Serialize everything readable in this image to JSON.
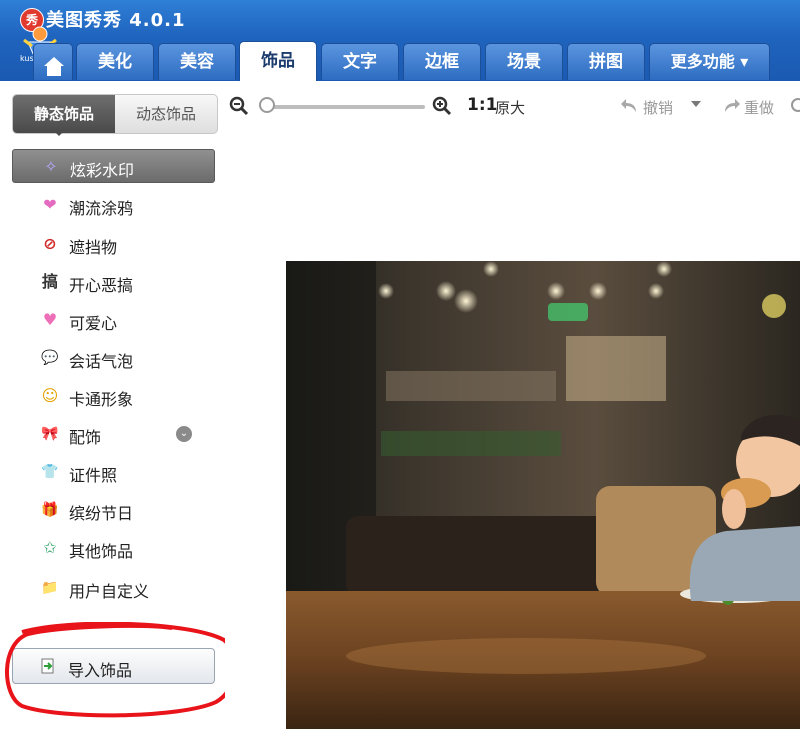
{
  "app": {
    "title": "美图秀秀 4.0.1",
    "logo_text": "秀",
    "mascot_text": "kusfoto"
  },
  "tabs": [
    {
      "label": "美化"
    },
    {
      "label": "美容"
    },
    {
      "label": "饰品",
      "active": true
    },
    {
      "label": "文字"
    },
    {
      "label": "边框"
    },
    {
      "label": "场景"
    },
    {
      "label": "拼图"
    },
    {
      "label": "更多功能 ▾"
    }
  ],
  "sidebar": {
    "segments": [
      "静态饰品",
      "动态饰品"
    ],
    "items": [
      {
        "label": "炫彩水印",
        "icon": "sparkle-icon",
        "glyph": "✧",
        "color": "#8b7bd6"
      },
      {
        "label": "潮流涂鸦",
        "icon": "lips-icon",
        "glyph": "❤",
        "color": "#e36cc0"
      },
      {
        "label": "遮挡物",
        "icon": "no-entry-icon",
        "glyph": "⊘",
        "color": "#d12a2a"
      },
      {
        "label": "开心恶搞",
        "icon": "gao-character-icon",
        "glyph": "搞",
        "color": "#333333"
      },
      {
        "label": "可爱心",
        "icon": "heart-icon",
        "glyph": "♥",
        "color": "#ec6fb7"
      },
      {
        "label": "会话气泡",
        "icon": "speech-bubble-icon",
        "glyph": "💬",
        "color": "#c73a3a"
      },
      {
        "label": "卡通形象",
        "icon": "cartoon-face-icon",
        "glyph": "☺",
        "color": "#e6a100"
      },
      {
        "label": "配饰",
        "icon": "bow-icon",
        "glyph": "🎀",
        "color": "#c23fc8"
      },
      {
        "label": "证件照",
        "icon": "shirt-icon",
        "glyph": "👕",
        "color": "#b05bd9"
      },
      {
        "label": "缤纷节日",
        "icon": "gift-icon",
        "glyph": "🎁",
        "color": "#2e9e4a"
      },
      {
        "label": "其他饰品",
        "icon": "star-icon",
        "glyph": "✩",
        "color": "#3aa56b"
      },
      {
        "label": "用户自定义",
        "icon": "folder-icon",
        "glyph": "📁",
        "color": "#e3a33a"
      }
    ],
    "import_button": "导入饰品"
  },
  "toolbar": {
    "zoom_ratio": "1:1",
    "actual_size": "原大",
    "undo": "撤销",
    "redo": "重做"
  }
}
